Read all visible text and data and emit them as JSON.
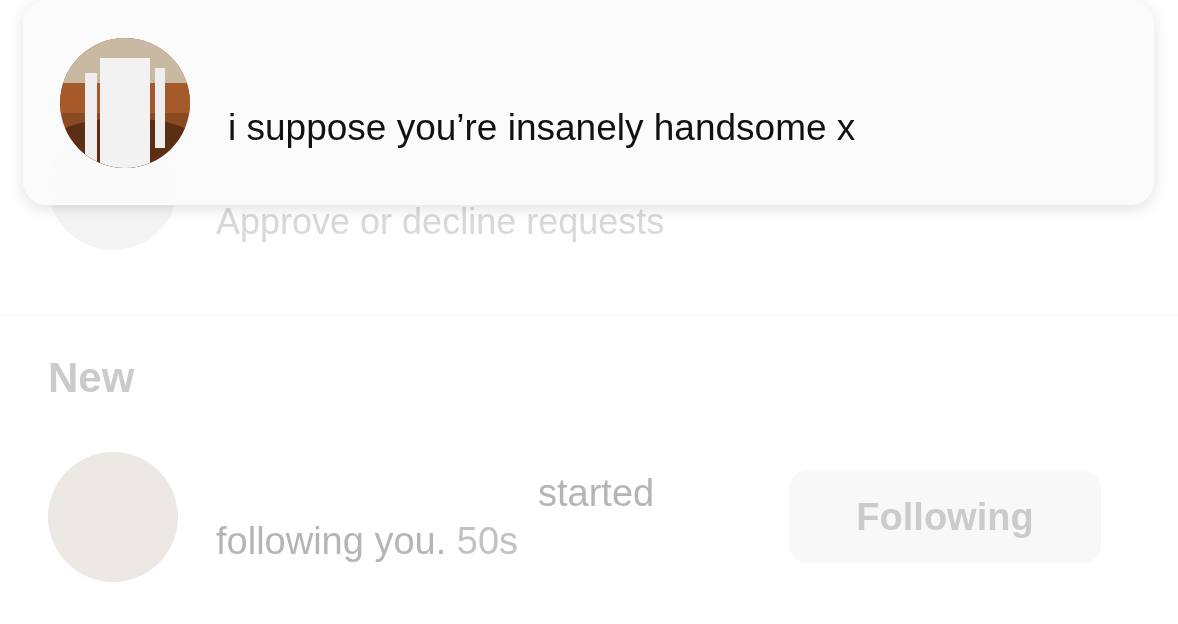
{
  "follow_requests": {
    "subtitle": "Approve or decline requests"
  },
  "section_title": "New",
  "activity": [
    {
      "text": "started following you.",
      "time": "50s",
      "button": "Following"
    }
  ],
  "banner": {
    "message": "i suppose you’re insanely handsome x"
  }
}
